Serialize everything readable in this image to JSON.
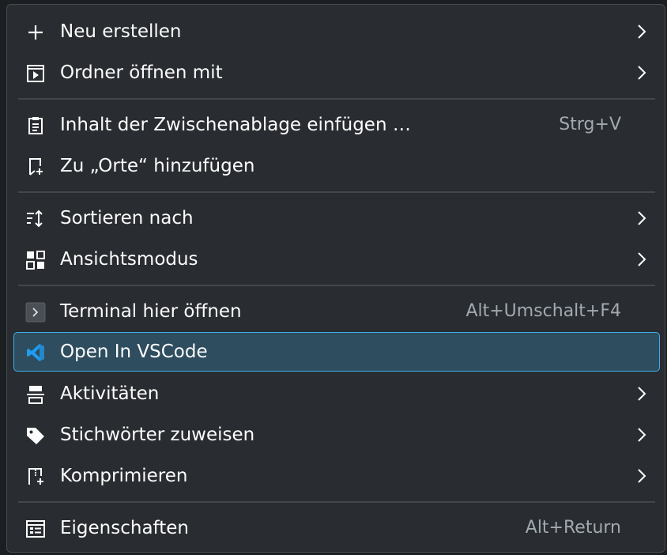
{
  "menu": {
    "items": [
      {
        "label": "Neu erstellen",
        "icon": "plus-icon",
        "submenu": true
      },
      {
        "label": "Ordner öffnen mit",
        "icon": "open-with-icon",
        "submenu": true
      },
      {
        "label": "Inhalt der Zwischenablage einfügen …",
        "icon": "clipboard-paste-icon",
        "shortcut": "Strg+V"
      },
      {
        "label": "Zu „Orte“ hinzufügen",
        "icon": "bookmark-add-icon"
      },
      {
        "label": "Sortieren nach",
        "icon": "sort-icon",
        "submenu": true
      },
      {
        "label": "Ansichtsmodus",
        "icon": "view-mode-icon",
        "submenu": true
      },
      {
        "label": "Terminal hier öffnen",
        "icon": "terminal-icon",
        "shortcut": "Alt+Umschalt+F4"
      },
      {
        "label": "Open In VSCode",
        "icon": "vscode-icon",
        "highlighted": true
      },
      {
        "label": "Aktivitäten",
        "icon": "activities-icon",
        "submenu": true
      },
      {
        "label": "Stichwörter zuweisen",
        "icon": "tag-icon",
        "submenu": true
      },
      {
        "label": "Komprimieren",
        "icon": "compress-icon",
        "submenu": true
      },
      {
        "label": "Eigenschaften",
        "icon": "properties-icon",
        "shortcut": "Alt+Return"
      }
    ]
  },
  "colors": {
    "background": "#292c30",
    "text": "#fcfcfc",
    "shortcut_text": "#a1a9b1",
    "highlight_fill": "#2e4d5f",
    "highlight_border": "#3daee9",
    "separator": "#43474c"
  }
}
